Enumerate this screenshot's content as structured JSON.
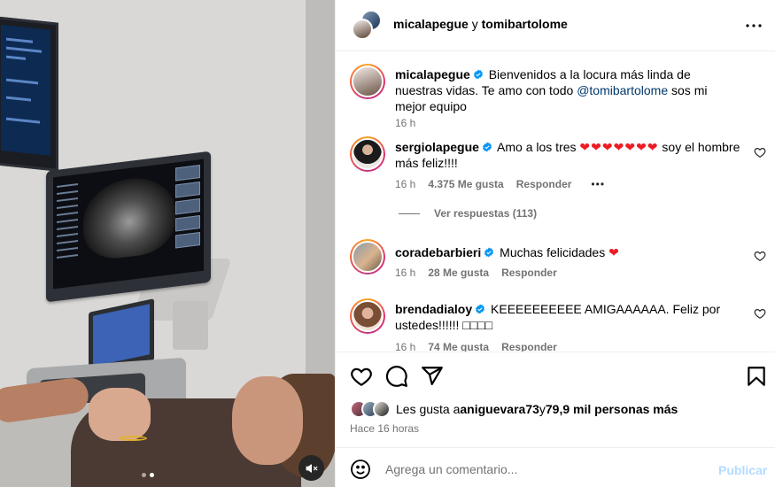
{
  "colors": {
    "verified": "#0095f6",
    "heart_red": "#ed1c24",
    "publish_disabled": "#b3dbff",
    "secondary_text": "#737373",
    "mention": "#00376b"
  },
  "header": {
    "user1": "micalapegue",
    "connector": "y",
    "user2": "tomibartolome",
    "more_icon": "more-horizontal-icon"
  },
  "caption": {
    "user": "micalapegue",
    "text_before": "Bienvenidos a la locura más linda de nuestras vidas. Te amo con todo ",
    "mention": "@tomibartolome",
    "text_after": " sos mi mejor equipo",
    "time": "16 h"
  },
  "comments": [
    {
      "user": "sergiolapegue",
      "text": "Amo a los tres ",
      "hearts": "❤❤❤❤❤❤❤",
      "text_after": " soy el hombre más feliz!!!!",
      "time": "16 h",
      "likes": "4.375 Me gusta",
      "reply": "Responder",
      "more": "•••"
    },
    {
      "user": "coradebarbieri",
      "text": "Muchas felicidades ",
      "hearts": "❤",
      "time": "16 h",
      "likes": "28 Me gusta",
      "reply": "Responder"
    },
    {
      "user": "brendadialoy",
      "text": "KEEEEEEEEEE AMIGAAAAAA. Feliz por ustedes!!!!!! ",
      "emoji_boxes": "□□□□",
      "time": "16 h",
      "likes": "74 Me gusta",
      "reply": "Responder"
    }
  ],
  "view_replies": "Ver respuestas (113)",
  "actions": {
    "like_icon": "heart-outline-icon",
    "comment_icon": "comment-icon",
    "share_icon": "send-icon",
    "save_icon": "bookmark-icon"
  },
  "likes_summary": {
    "prefix": "Les gusta a ",
    "user": "aniguevara73",
    "middle": " y ",
    "count": "79,9 mil personas más"
  },
  "posted_ago": "Hace 16 horas",
  "composer": {
    "placeholder": "Agrega un comentario...",
    "publish": "Publicar",
    "emoji_icon": "smiley-icon"
  },
  "carousel": {
    "count": 2,
    "active": 2
  },
  "media": {
    "mute_icon": "muted-speaker-icon"
  }
}
